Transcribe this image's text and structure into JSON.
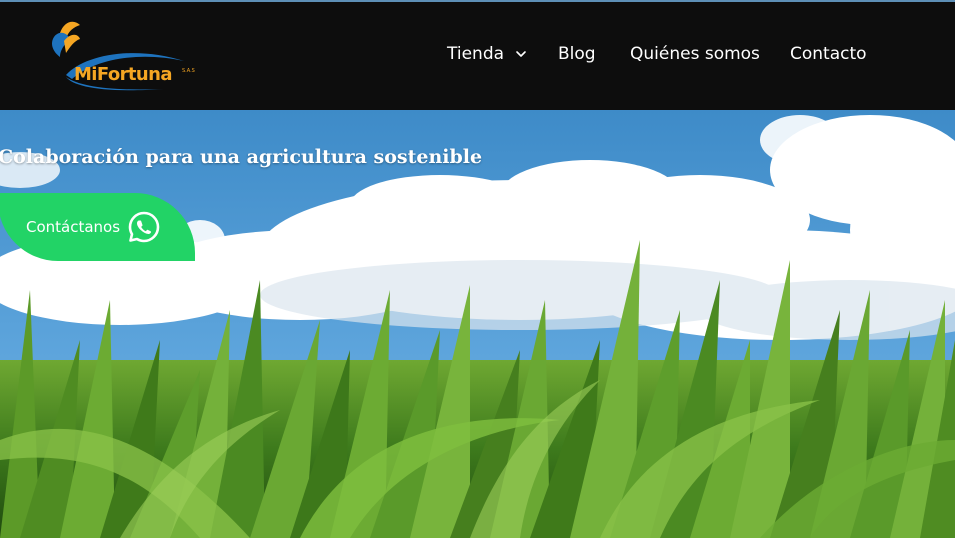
{
  "brand": {
    "name": "MiFortuna",
    "suffix": "S.A.S",
    "colors": {
      "orange": "#f5a623",
      "blue": "#1e73be",
      "header_bg": "#0d0d0d"
    }
  },
  "nav": {
    "items": [
      {
        "label": "Tienda",
        "has_dropdown": true,
        "icon": "chevron-down-icon"
      },
      {
        "label": "Blog"
      },
      {
        "label": "Quiénes somos"
      },
      {
        "label": "Contacto"
      }
    ]
  },
  "hero": {
    "title": "Colaboración para una agricultura sostenible",
    "cta": {
      "label": "Contáctanos",
      "icon": "whatsapp-icon",
      "color": "#22d366"
    }
  }
}
